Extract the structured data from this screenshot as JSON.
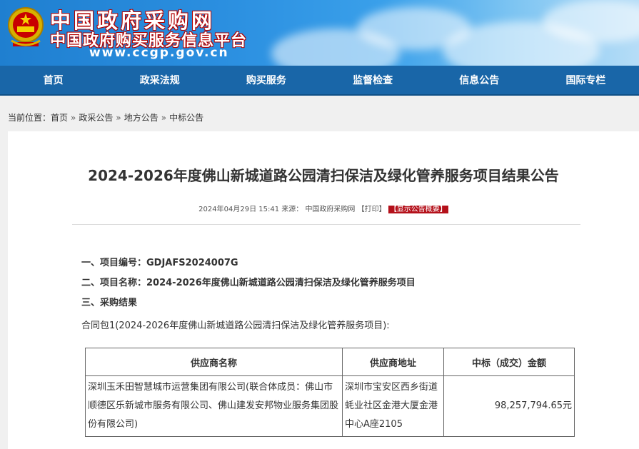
{
  "header": {
    "title": "中国政府采购网",
    "subtitle": "中国政府购买服务信息平台",
    "url": "www.ccgp.gov.cn"
  },
  "nav": [
    "首页",
    "政采法规",
    "购买服务",
    "监督检查",
    "信息公告",
    "国际专栏"
  ],
  "breadcrumb": {
    "prefix": "当前位置：",
    "items": [
      "首页",
      "政采公告",
      "地方公告",
      "中标公告"
    ],
    "sep": "»"
  },
  "article": {
    "title": "2024-2026年度佛山新城道路公园清扫保洁及绿化管养服务项目结果公告",
    "meta_date": "2024年04月29日 15:41 来源：",
    "meta_source": "中国政府采购网",
    "meta_print": "【打印】",
    "meta_summary": "【显示公告概要】",
    "lines": [
      "一、项目编号：GDJAFS2024007G",
      "二、项目名称：2024-2026年度佛山新城道路公园清扫保洁及绿化管养服务项目",
      "三、采购结果",
      "合同包1(2024-2026年度佛山新城道路公园清扫保洁及绿化管养服务项目):"
    ]
  },
  "table": {
    "headers": [
      "供应商名称",
      "供应商地址",
      "中标（成交）金额"
    ],
    "rows": [
      {
        "name": "深圳玉禾田智慧城市运营集团有限公司(联合体成员：佛山市顺德区乐新城市服务有限公司、佛山建发安邦物业服务集团股份有限公司)",
        "address": "深圳市宝安区西乡街道蚝业社区金港大厦金港中心A座2105",
        "amount": "98,257,794.65元"
      }
    ]
  },
  "colors": {
    "nav": "#1966a8",
    "summary": "#b4101a"
  }
}
